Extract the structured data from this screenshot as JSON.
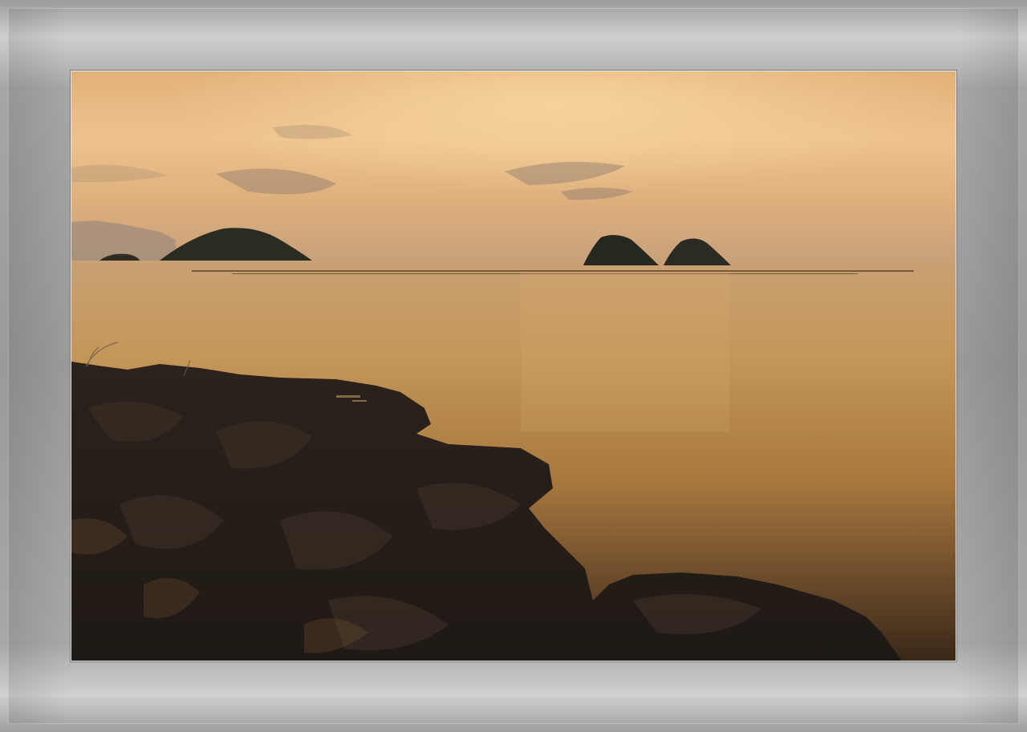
{
  "photo": {
    "subject": "sunset-seascape",
    "colors": {
      "sky_top": "#e9b77a",
      "sky_mid": "#eec38c",
      "horizon": "#c49a6c",
      "water": "#b8864c",
      "water_dark": "#3b2a1c",
      "rock": "#2a221c"
    }
  }
}
